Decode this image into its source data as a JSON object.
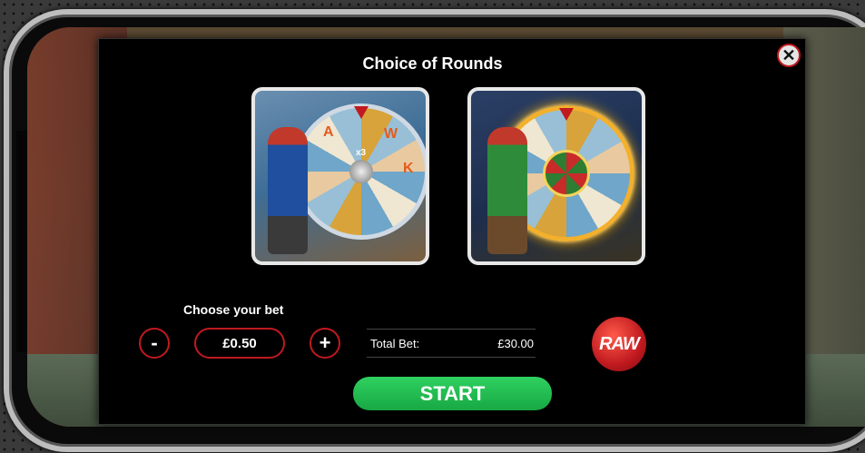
{
  "modal": {
    "title": "Choice of Rounds",
    "close_icon": "close-icon"
  },
  "round_options": [
    {
      "name": "wheel-option-standard",
      "multiplier": "x3",
      "letters": [
        "A",
        "W",
        "K"
      ]
    },
    {
      "name": "wheel-option-golden"
    }
  ],
  "bet": {
    "label": "Choose your bet",
    "decrease_label": "-",
    "increase_label": "+",
    "value": "£0.50",
    "total_label": "Total Bet:",
    "total_value": "£30.00"
  },
  "logo": {
    "text": "RAW"
  },
  "start_label": "START",
  "colors": {
    "accent": "#c0191f",
    "start": "#22c052",
    "modal_bg": "#000000"
  }
}
